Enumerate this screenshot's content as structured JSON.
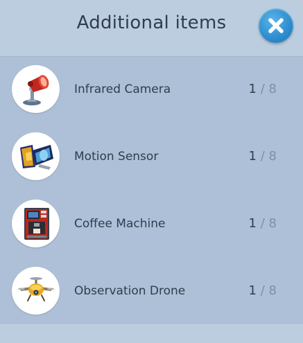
{
  "header": {
    "title": "Additional items",
    "close_icon": "close-x-icon"
  },
  "items": [
    {
      "name": "Infrared Camera",
      "have": "1",
      "separator": "/",
      "total": "8",
      "icon": "infrared-camera-icon"
    },
    {
      "name": "Motion Sensor",
      "have": "1",
      "separator": "/",
      "total": "8",
      "icon": "motion-sensor-icon"
    },
    {
      "name": "Coffee Machine",
      "have": "1",
      "separator": "/",
      "total": "8",
      "icon": "coffee-machine-icon"
    },
    {
      "name": "Observation Drone",
      "have": "1",
      "separator": "/",
      "total": "8",
      "icon": "observation-drone-icon"
    }
  ],
  "colors": {
    "panel_bg": "#b9cade",
    "list_bg": "#adc0d7",
    "close_button": "#2f8fd0",
    "text_dark": "#2f3d4d",
    "text_muted": "#7d8fa4"
  }
}
